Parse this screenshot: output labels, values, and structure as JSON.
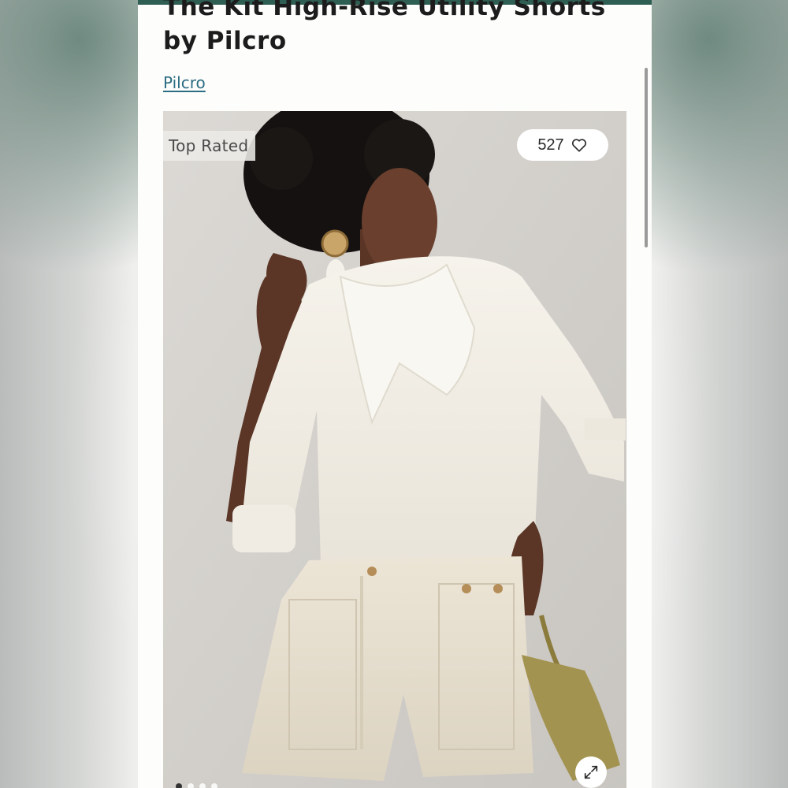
{
  "product": {
    "title": "The Kit High-Rise Utility Shorts by Pilcro",
    "brand_link": "Pilcro"
  },
  "gallery": {
    "badge": "Top Rated",
    "favorites_count": "527",
    "favorite_icon": "heart-icon",
    "expand_icon": "expand-icon",
    "image_count": 4,
    "active_image": 1
  },
  "colors": {
    "top_bar": "#2f5e52",
    "link": "#2b6d83",
    "page_background": "#fdfdfb"
  }
}
